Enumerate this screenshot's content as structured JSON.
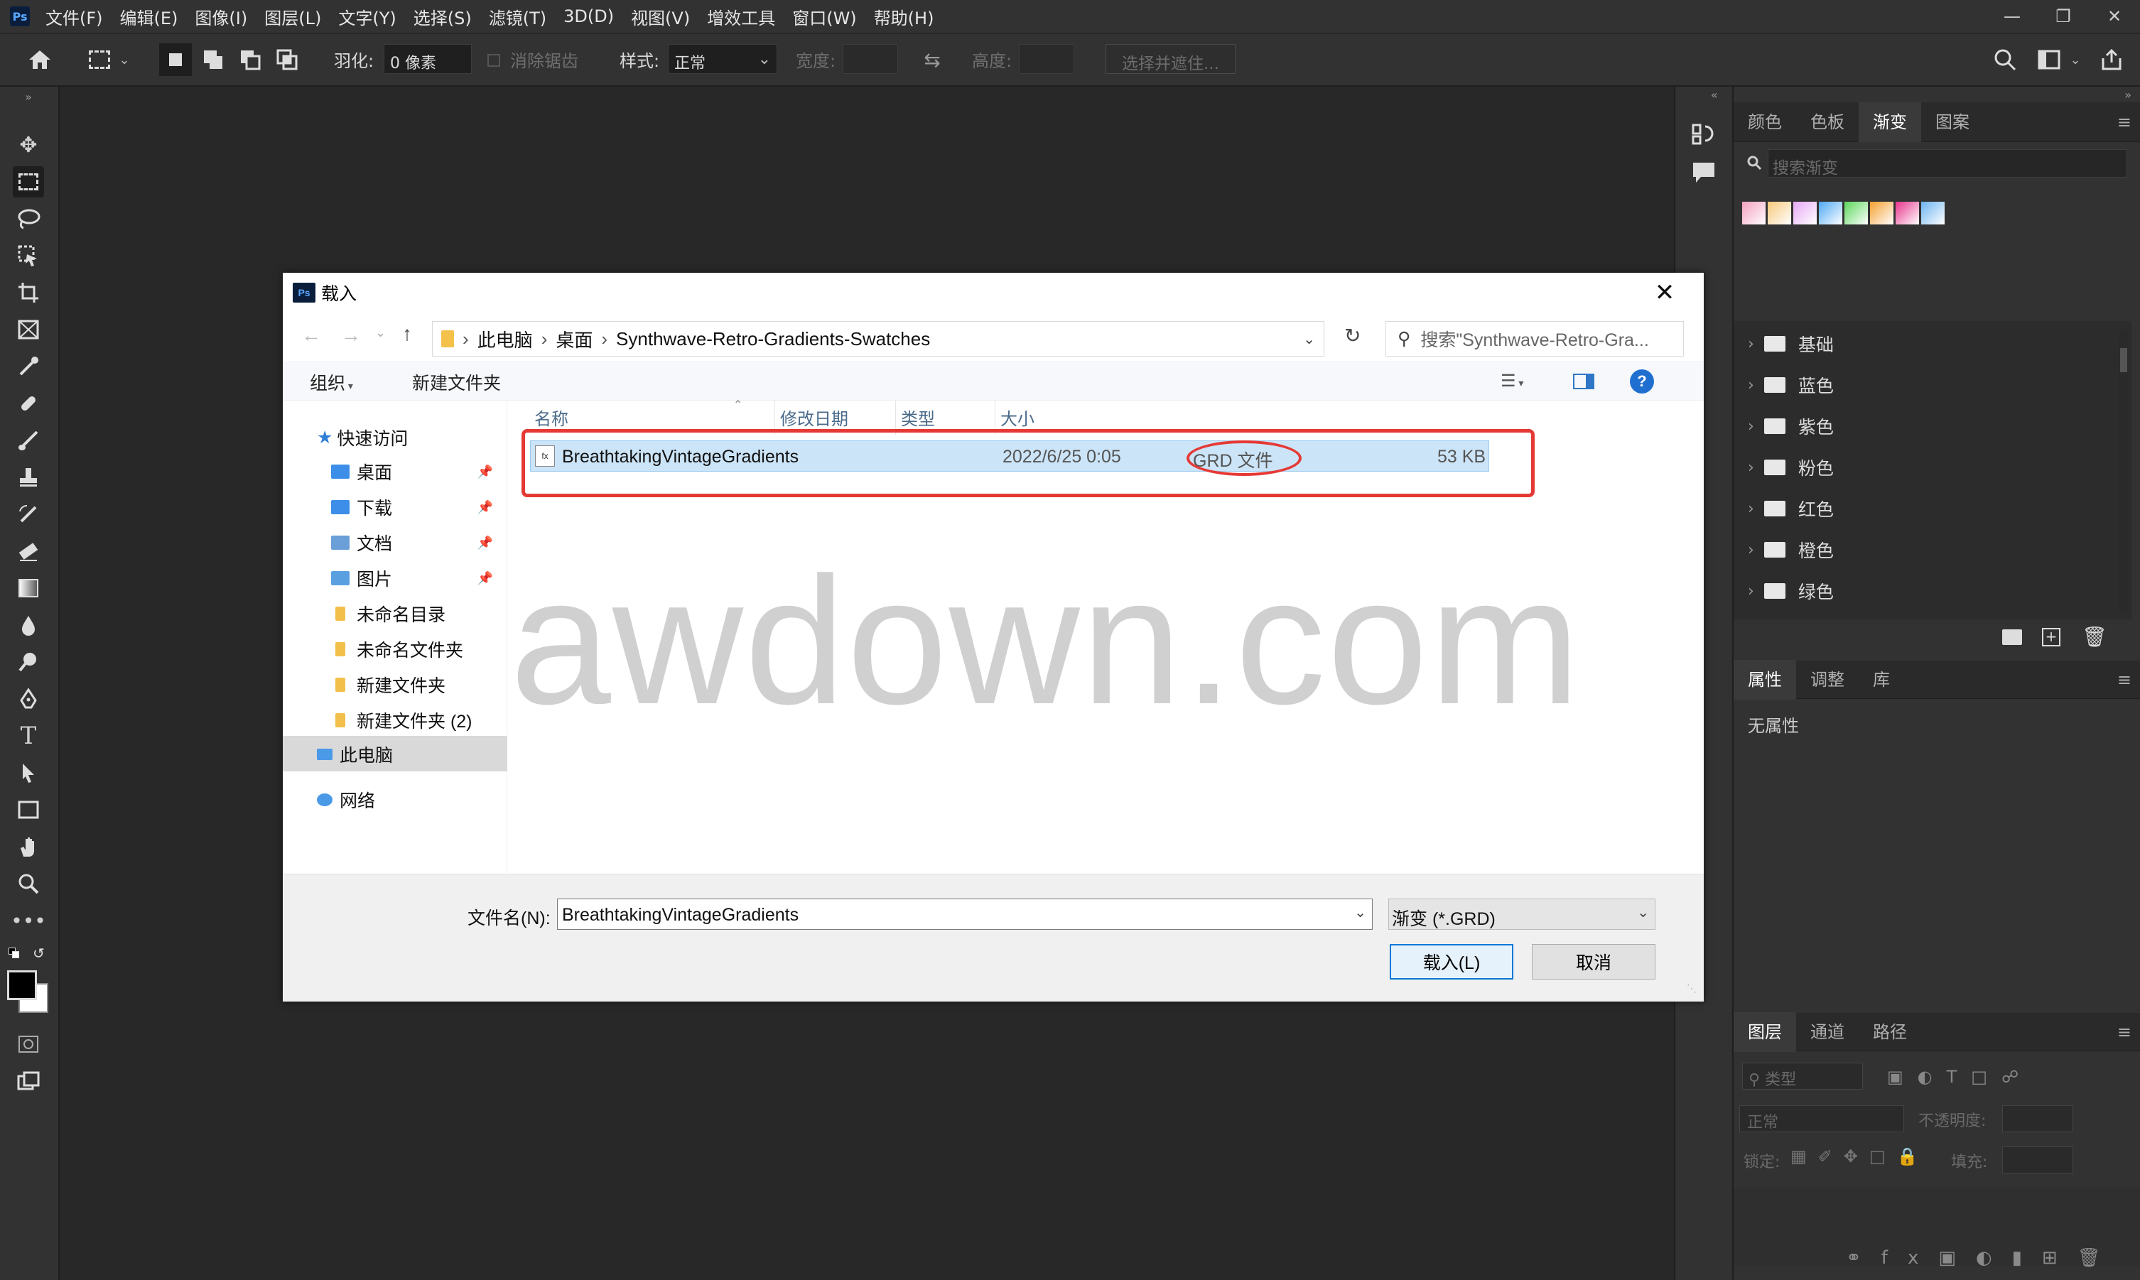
{
  "app": {
    "logo": "Ps",
    "menu": [
      "文件(F)",
      "编辑(E)",
      "图像(I)",
      "图层(L)",
      "文字(Y)",
      "选择(S)",
      "滤镜(T)",
      "3D(D)",
      "视图(V)",
      "增效工具",
      "窗口(W)",
      "帮助(H)"
    ]
  },
  "options": {
    "feather_label": "羽化:",
    "feather_value": "0 像素",
    "antialias_label": "消除锯齿",
    "style_label": "样式:",
    "style_value": "正常",
    "width_label": "宽度:",
    "height_label": "高度:",
    "select_mask_button": "选择并遮住..."
  },
  "panels": {
    "top_tabs": [
      "颜色",
      "色板",
      "渐变",
      "图案"
    ],
    "search_placeholder": "搜索渐变",
    "swatch_colors": [
      "#f4a0c0",
      "#f7c87a",
      "#e7a8f5",
      "#4ea8f5",
      "#5bd65a",
      "#f5a030",
      "#e8348c",
      "#6cb4f0"
    ],
    "gradient_groups": [
      "基础",
      "蓝色",
      "紫色",
      "粉色",
      "红色",
      "橙色",
      "绿色"
    ],
    "props_tabs": [
      "属性",
      "调整",
      "库"
    ],
    "no_props": "无属性",
    "layers_tabs": [
      "图层",
      "通道",
      "路径"
    ],
    "layer_filter": "类型",
    "blend_mode": "正常",
    "opacity_label": "不透明度:",
    "lock_label": "锁定:",
    "fill_label": "填充:"
  },
  "dialog": {
    "title_icon": "Ps",
    "title": "载入",
    "breadcrumb": [
      "此电脑",
      "桌面",
      "Synthwave-Retro-Gradients-Swatches"
    ],
    "search_placeholder": "搜索\"Synthwave-Retro-Gra...",
    "organize": "组织",
    "new_folder": "新建文件夹",
    "nav": {
      "quick_access": "快速访问",
      "items": [
        "桌面",
        "下载",
        "文档",
        "图片",
        "未命名目录",
        "未命名文件夹",
        "新建文件夹",
        "新建文件夹 (2)"
      ],
      "this_pc": "此电脑",
      "network": "网络"
    },
    "columns": [
      "名称",
      "修改日期",
      "类型",
      "大小"
    ],
    "file": {
      "name": "BreathtakingVintageGradients",
      "date": "2022/6/25 0:05",
      "type": "GRD 文件",
      "size": "53 KB"
    },
    "watermark": "awdown.com",
    "filename_label": "文件名(N):",
    "filename_value": "BreathtakingVintageGradients",
    "filetype": "渐变 (*.GRD)",
    "load_button": "载入(L)",
    "cancel_button": "取消"
  }
}
